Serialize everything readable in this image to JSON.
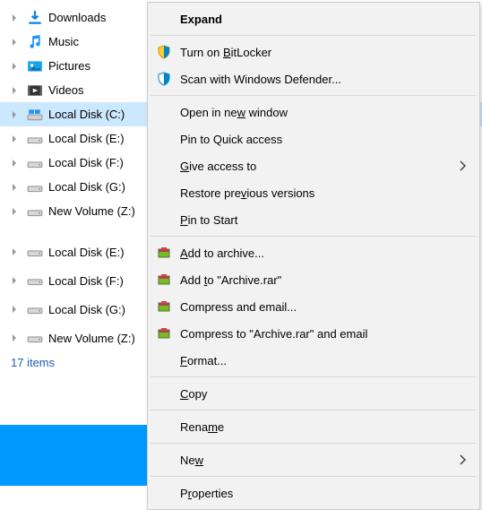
{
  "tree": {
    "items": [
      {
        "label": "Downloads",
        "icon": "download-icon",
        "indent": 0,
        "selected": false,
        "chevron": true
      },
      {
        "label": "Music",
        "icon": "music-icon",
        "indent": 0,
        "selected": false,
        "chevron": true
      },
      {
        "label": "Pictures",
        "icon": "pictures-icon",
        "indent": 0,
        "selected": false,
        "chevron": true
      },
      {
        "label": "Videos",
        "icon": "videos-icon",
        "indent": 0,
        "selected": false,
        "chevron": true
      },
      {
        "label": "Local Disk (C:)",
        "icon": "windisk-icon",
        "indent": 0,
        "selected": true,
        "chevron": true
      },
      {
        "label": "Local Disk (E:)",
        "icon": "disk-icon",
        "indent": 0,
        "selected": false,
        "chevron": true
      },
      {
        "label": "Local Disk (F:)",
        "icon": "disk-icon",
        "indent": 0,
        "selected": false,
        "chevron": true
      },
      {
        "label": "Local Disk (G:)",
        "icon": "disk-icon",
        "indent": 0,
        "selected": false,
        "chevron": true
      },
      {
        "label": "New Volume (Z:)",
        "icon": "disk-icon",
        "indent": 0,
        "selected": false,
        "chevron": true
      },
      {
        "label": "Local Disk (E:)",
        "icon": "disk-icon",
        "indent": 1,
        "selected": false,
        "chevron": true
      },
      {
        "label": "Local Disk (F:)",
        "icon": "disk-icon",
        "indent": 1,
        "selected": false,
        "chevron": true
      },
      {
        "label": "Local Disk (G:)",
        "icon": "disk-icon",
        "indent": 1,
        "selected": false,
        "chevron": true
      },
      {
        "label": "New Volume (Z:)",
        "icon": "disk-icon",
        "indent": 1,
        "selected": false,
        "chevron": true
      }
    ]
  },
  "status": {
    "text": "17 items"
  },
  "context_menu": {
    "groups": [
      [
        {
          "label": "Expand",
          "bold": true
        }
      ],
      [
        {
          "label": "Turn on BitLocker",
          "icon": "shield-yellow-icon",
          "hotkey": "B"
        },
        {
          "label": "Scan with Windows Defender...",
          "icon": "shield-blue-icon"
        }
      ],
      [
        {
          "label": "Open in new window",
          "hotkey": "w"
        },
        {
          "label": "Pin to Quick access"
        },
        {
          "label": "Give access to",
          "hotkey": "G",
          "submenu": true
        },
        {
          "label": "Restore previous versions",
          "hotkey": "v"
        },
        {
          "label": "Pin to Start",
          "hotkey": "P"
        }
      ],
      [
        {
          "label": "Add to archive...",
          "icon": "winrar-icon",
          "hotkey": "A"
        },
        {
          "label": "Add to \"Archive.rar\"",
          "icon": "winrar-icon",
          "hotkey": "t"
        },
        {
          "label": "Compress and email...",
          "icon": "winrar-icon"
        },
        {
          "label": "Compress to \"Archive.rar\" and email",
          "icon": "winrar-icon"
        },
        {
          "label": "Format...",
          "hotkey": "F"
        }
      ],
      [
        {
          "label": "Copy",
          "hotkey": "C"
        }
      ],
      [
        {
          "label": "Rename",
          "hotkey": "m"
        }
      ],
      [
        {
          "label": "New",
          "hotkey": "w",
          "submenu": true
        }
      ],
      [
        {
          "label": "Properties",
          "hotkey": "r"
        }
      ]
    ]
  }
}
